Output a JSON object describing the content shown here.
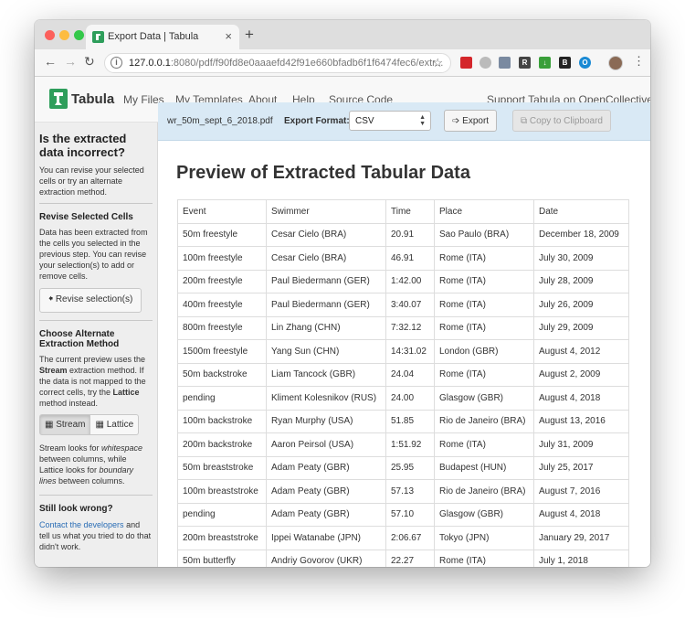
{
  "browser": {
    "tab_title": "Export Data | Tabula",
    "tab_close": "×",
    "new_tab": "+",
    "url_host": "127.0.0.1",
    "url_rest": ":8080/pdf/f90fd8e0aaaefd42f91e660bfadb6f1f6474fec6/extr...",
    "star": "☆",
    "menu": "⋮"
  },
  "navbar": {
    "brand": "Tabula",
    "links": [
      "My Files",
      "My Templates",
      "About",
      "Help",
      "Source Code"
    ],
    "support": "Support Tabula on OpenCollective!"
  },
  "sidebar": {
    "heading": "Is the extracted data incorrect?",
    "intro": "You can revise your selected cells or try an alternate extraction method.",
    "revise_heading": "Revise Selected Cells",
    "revise_text": "Data has been extracted from the cells you selected in the previous step. You can revise your selection(s) to add or remove cells.",
    "revise_button": "Revise selection(s)",
    "method_heading": "Choose Alternate Extraction Method",
    "method_text_1": "The current preview uses the ",
    "method_current": "Stream",
    "method_text_2": " extraction method. If the data is not mapped to the correct cells, try the ",
    "method_alt": "Lattice",
    "method_text_3": " method instead.",
    "stream_button": "Stream",
    "lattice_button": "Lattice",
    "explain_1": "Stream looks for ",
    "explain_ws": "whitespace",
    "explain_2": " between columns, while Lattice looks for ",
    "explain_bl": "boundary lines",
    "explain_3": " between columns.",
    "still_heading": "Still look wrong?",
    "contact_link": "Contact the developers",
    "contact_text": " and tell us what you tried to do that didn't work."
  },
  "export_bar": {
    "filename": "wr_50m_sept_6_2018.pdf",
    "format_label": "Export Format:",
    "format_value": "CSV",
    "export_button": "Export",
    "copy_button": "Copy to Clipboard"
  },
  "main": {
    "title": "Preview of Extracted Tabular Data",
    "columns": [
      "Event",
      "Swimmer",
      "Time",
      "Place",
      "Date"
    ],
    "rows": [
      [
        "50m freestyle",
        "Cesar Cielo (BRA)",
        "20.91",
        "Sao Paulo (BRA)",
        "December 18, 2009"
      ],
      [
        "100m freestyle",
        "Cesar Cielo (BRA)",
        "46.91",
        "Rome (ITA)",
        "July 30, 2009"
      ],
      [
        "200m freestyle",
        "Paul Biedermann (GER)",
        "1:42.00",
        "Rome (ITA)",
        "July 28, 2009"
      ],
      [
        "400m freestyle",
        "Paul Biedermann (GER)",
        "3:40.07",
        "Rome (ITA)",
        "July 26, 2009"
      ],
      [
        "800m freestyle",
        "Lin Zhang (CHN)",
        "7:32.12",
        "Rome (ITA)",
        "July 29, 2009"
      ],
      [
        "1500m freestyle",
        "Yang Sun (CHN)",
        "14:31.02",
        "London (GBR)",
        "August 4, 2012"
      ],
      [
        "50m backstroke",
        "Liam Tancock (GBR)",
        "24.04",
        "Rome (ITA)",
        "August 2, 2009"
      ],
      [
        "pending",
        "Kliment Kolesnikov (RUS)",
        "24.00",
        "Glasgow (GBR)",
        "August 4, 2018"
      ],
      [
        "100m backstroke",
        "Ryan Murphy (USA)",
        "51.85",
        "Rio de Janeiro (BRA)",
        "August 13, 2016"
      ],
      [
        "200m backstroke",
        "Aaron Peirsol (USA)",
        "1:51.92",
        "Rome (ITA)",
        "July 31, 2009"
      ],
      [
        "50m breaststroke",
        "Adam Peaty (GBR)",
        "25.95",
        "Budapest (HUN)",
        "July 25, 2017"
      ],
      [
        "100m breaststroke",
        "Adam Peaty (GBR)",
        "57.13",
        "Rio de Janeiro (BRA)",
        "August 7, 2016"
      ],
      [
        "pending",
        "Adam Peaty (GBR)",
        "57.10",
        "Glasgow (GBR)",
        "August 4, 2018"
      ],
      [
        "200m breaststroke",
        "Ippei Watanabe (JPN)",
        "2:06.67",
        "Tokyo (JPN)",
        "January 29, 2017"
      ],
      [
        "50m butterfly",
        "Andriy Govorov (UKR)",
        "22.27",
        "Rome (ITA)",
        "July 1, 2018"
      ]
    ]
  },
  "colors": {
    "export_bar_bg": "#d9e9f5",
    "sidebar_bg": "#eeeeee",
    "link": "#2a6db5",
    "brand_green": "#2e9e5b"
  },
  "icons": [
    "tabula-logo-icon",
    "arrow-left-icon",
    "arrow-right-icon",
    "reload-icon",
    "info-icon",
    "star-icon",
    "export-icon",
    "copy-icon",
    "grid-icon",
    "table-icon"
  ]
}
